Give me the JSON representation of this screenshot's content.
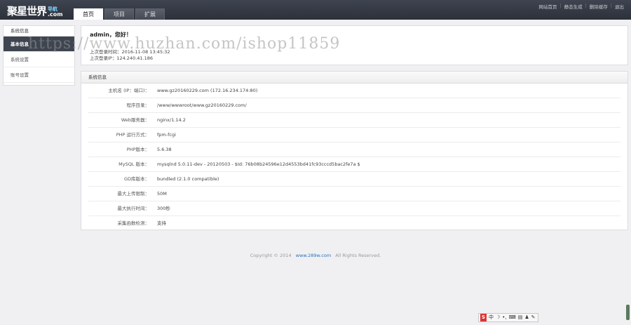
{
  "logo": {
    "text": "聚星世界",
    "tag": "导航",
    "domain": ".com"
  },
  "tabs": [
    {
      "label": "首页",
      "active": true
    },
    {
      "label": "项目",
      "active": false
    },
    {
      "label": "扩展",
      "active": false
    }
  ],
  "top_links": [
    "网站首页",
    "静态生成",
    "删除缓存",
    "退出"
  ],
  "sidebar": {
    "title": "系统信息",
    "items": [
      {
        "label": "基本信息",
        "active": true
      },
      {
        "label": "系统设置",
        "active": false
      },
      {
        "label": "账号设置",
        "active": false
      }
    ]
  },
  "welcome": {
    "greeting": "admin，您好！",
    "last_login_time": "上次登录时间：2016-11-08 13:45:32",
    "last_login_ip": "上次登录IP：124.240.41.186"
  },
  "sysinfo": {
    "title": "系统信息",
    "rows": [
      {
        "key": "主机名 (IP：端口)：",
        "value": "www.gz20160229.com (172.16.234.174:80)"
      },
      {
        "key": "程序目录：",
        "value": "/www/wwwroot/www.gz20160229.com/"
      },
      {
        "key": "Web服务器：",
        "value": "nginx/1.14.2"
      },
      {
        "key": "PHP 运行方式：",
        "value": "fpm-fcgi"
      },
      {
        "key": "PHP版本：",
        "value": "5.6.38"
      },
      {
        "key": "MySQL 版本：",
        "value": "mysqlnd 5.0.11-dev - 20120503 - $Id: 76b08b24596e12d4553bd41fc93cccd5bac2fe7a $"
      },
      {
        "key": "GD库版本：",
        "value": "bundled (2.1.0 compatible)"
      },
      {
        "key": "最大上传限制：",
        "value": "50M"
      },
      {
        "key": "最大执行时间：",
        "value": "300秒"
      },
      {
        "key": "采集函数检测：",
        "value": "支持"
      }
    ]
  },
  "footer": {
    "prefix": "Copyright © 2014",
    "link": "www.289w.com",
    "suffix": "All Rights Reserved."
  },
  "watermark": "https://www.huzhan.com/ishop11859",
  "ime": {
    "items": [
      "S",
      "中",
      "☽",
      "•,",
      "⌨",
      "▤",
      "♟",
      "✎"
    ]
  }
}
